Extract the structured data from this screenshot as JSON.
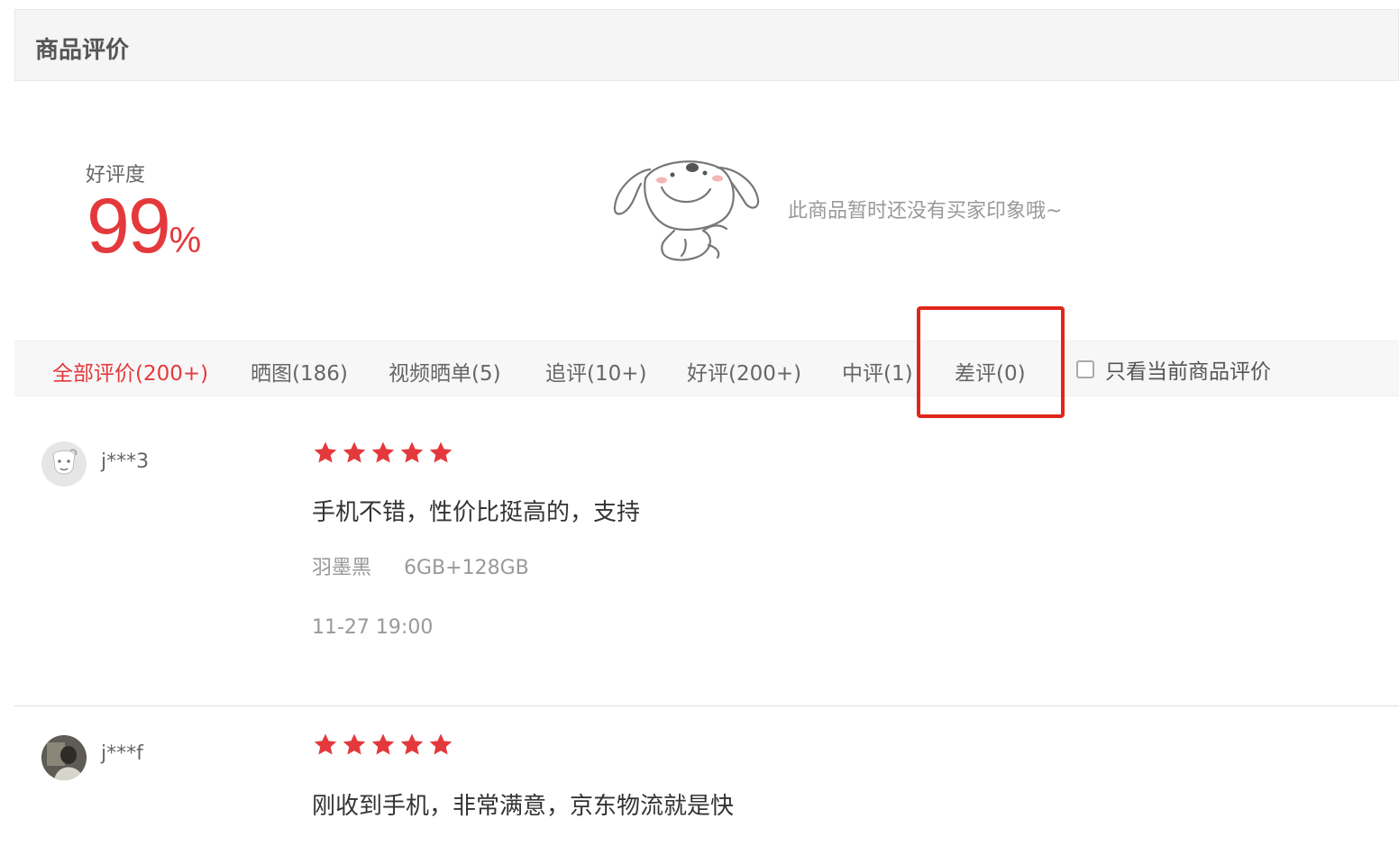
{
  "section": {
    "title": "商品评价"
  },
  "rating": {
    "label": "好评度",
    "value": "99",
    "unit": "%"
  },
  "impressions": {
    "empty_text": "此商品暂时还没有买家印象哦~"
  },
  "filters": {
    "tabs": [
      {
        "label": "全部评价(200+)",
        "active": true
      },
      {
        "label": "晒图(186)",
        "active": false
      },
      {
        "label": "视频晒单(5)",
        "active": false
      },
      {
        "label": "追评(10+)",
        "active": false
      },
      {
        "label": "好评(200+)",
        "active": false
      },
      {
        "label": "中评(1)",
        "active": false
      },
      {
        "label": "差评(0)",
        "active": false
      }
    ],
    "only_current": {
      "label": "只看当前商品评价",
      "checked": false
    }
  },
  "reviews": [
    {
      "user": "j***3",
      "stars": 5,
      "text": "手机不错，性价比挺高的，支持",
      "color": "羽墨黑",
      "spec": "6GB+128GB",
      "time": "11-27 19:00"
    },
    {
      "user": "j***f",
      "stars": 5,
      "text": "刚收到手机，非常满意，京东物流就是快"
    }
  ],
  "colors": {
    "accent": "#e4393c",
    "highlight": "#e0261b"
  },
  "icons": {
    "star": "star-icon",
    "mascot": "joy-dog-mascot",
    "avatar": "user-avatar"
  }
}
